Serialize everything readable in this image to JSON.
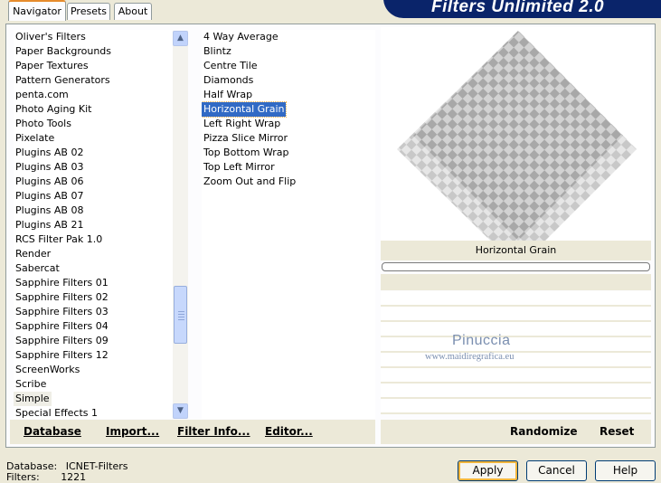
{
  "app": {
    "title": "Filters Unlimited 2.0"
  },
  "tabs": [
    "Navigator",
    "Presets",
    "About"
  ],
  "categories": {
    "items": [
      "Oliver's Filters",
      "Paper Backgrounds",
      "Paper Textures",
      "Pattern Generators",
      "penta.com",
      "Photo Aging Kit",
      "Photo Tools",
      "Pixelate",
      "Plugins AB 02",
      "Plugins AB 03",
      "Plugins AB 06",
      "Plugins AB 07",
      "Plugins AB 08",
      "Plugins AB 21",
      "RCS Filter Pak 1.0",
      "Render",
      "Sabercat",
      "Sapphire Filters 01",
      "Sapphire Filters 02",
      "Sapphire Filters 03",
      "Sapphire Filters 04",
      "Sapphire Filters 09",
      "Sapphire Filters 12",
      "ScreenWorks",
      "Scribe",
      "Simple",
      "Special Effects 1"
    ],
    "highlighted": "Simple"
  },
  "filters": {
    "items": [
      "4 Way Average",
      "Blintz",
      "Centre Tile",
      "Diamonds",
      "Half Wrap",
      "Horizontal Grain",
      "Left Right Wrap",
      "Pizza Slice Mirror",
      "Top Bottom Wrap",
      "Top Left Mirror",
      "Zoom Out and Flip"
    ],
    "selected": "Horizontal Grain"
  },
  "preview": {
    "filter_name": "Horizontal Grain"
  },
  "watermark": {
    "name": "Pinuccia",
    "url": "www.maidiregrafica.eu"
  },
  "toolbar": {
    "database": "Database",
    "import": "Import...",
    "filter_info": "Filter Info...",
    "editor": "Editor...",
    "randomize": "Randomize",
    "reset": "Reset"
  },
  "status": {
    "database_label": "Database:",
    "database_value": "ICNET-Filters",
    "filters_label": "Filters:",
    "filters_value": "1221"
  },
  "buttons": {
    "apply": "Apply",
    "cancel": "Cancel",
    "help": "Help"
  },
  "colors": {
    "selection": "#316ac5",
    "banner": "#0a246a",
    "face": "#ece9d8"
  }
}
